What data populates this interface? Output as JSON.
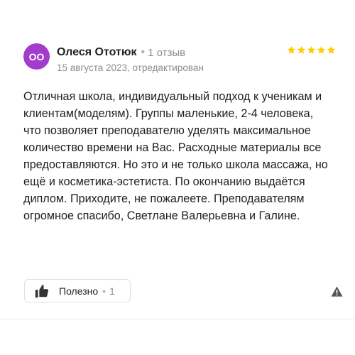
{
  "review": {
    "author": {
      "avatar_initials": "ОО",
      "avatar_color": "#a33ccd",
      "name": "Олеся Ототюк",
      "separator": "•",
      "reviews_count": "1 отзыв"
    },
    "date": "15 августа 2023, отредактирован",
    "rating": 5,
    "rating_max": 5,
    "star_color": "#fc0",
    "text": "Отличная школа, индивидуальный подход к ученикам и клиентам(моделям). Группы маленькие, 2-4 человека, что позволяет преподавателю уделять максимальное количество времени на Вас. Расходные материалы все предоставляются. Но это и не только школа массажа, но ещё и косметика-эстетиста. По окончанию выдаётся диплом. Приходите, не пожалеете. Преподавателям огромное спасибо, Светлане Валерьевна и Галине.",
    "actions": {
      "useful_icon": "thumbs-up-icon",
      "useful_label": "Полезно",
      "useful_separator": "•",
      "useful_count": "1",
      "report_icon": "warning-icon"
    }
  }
}
